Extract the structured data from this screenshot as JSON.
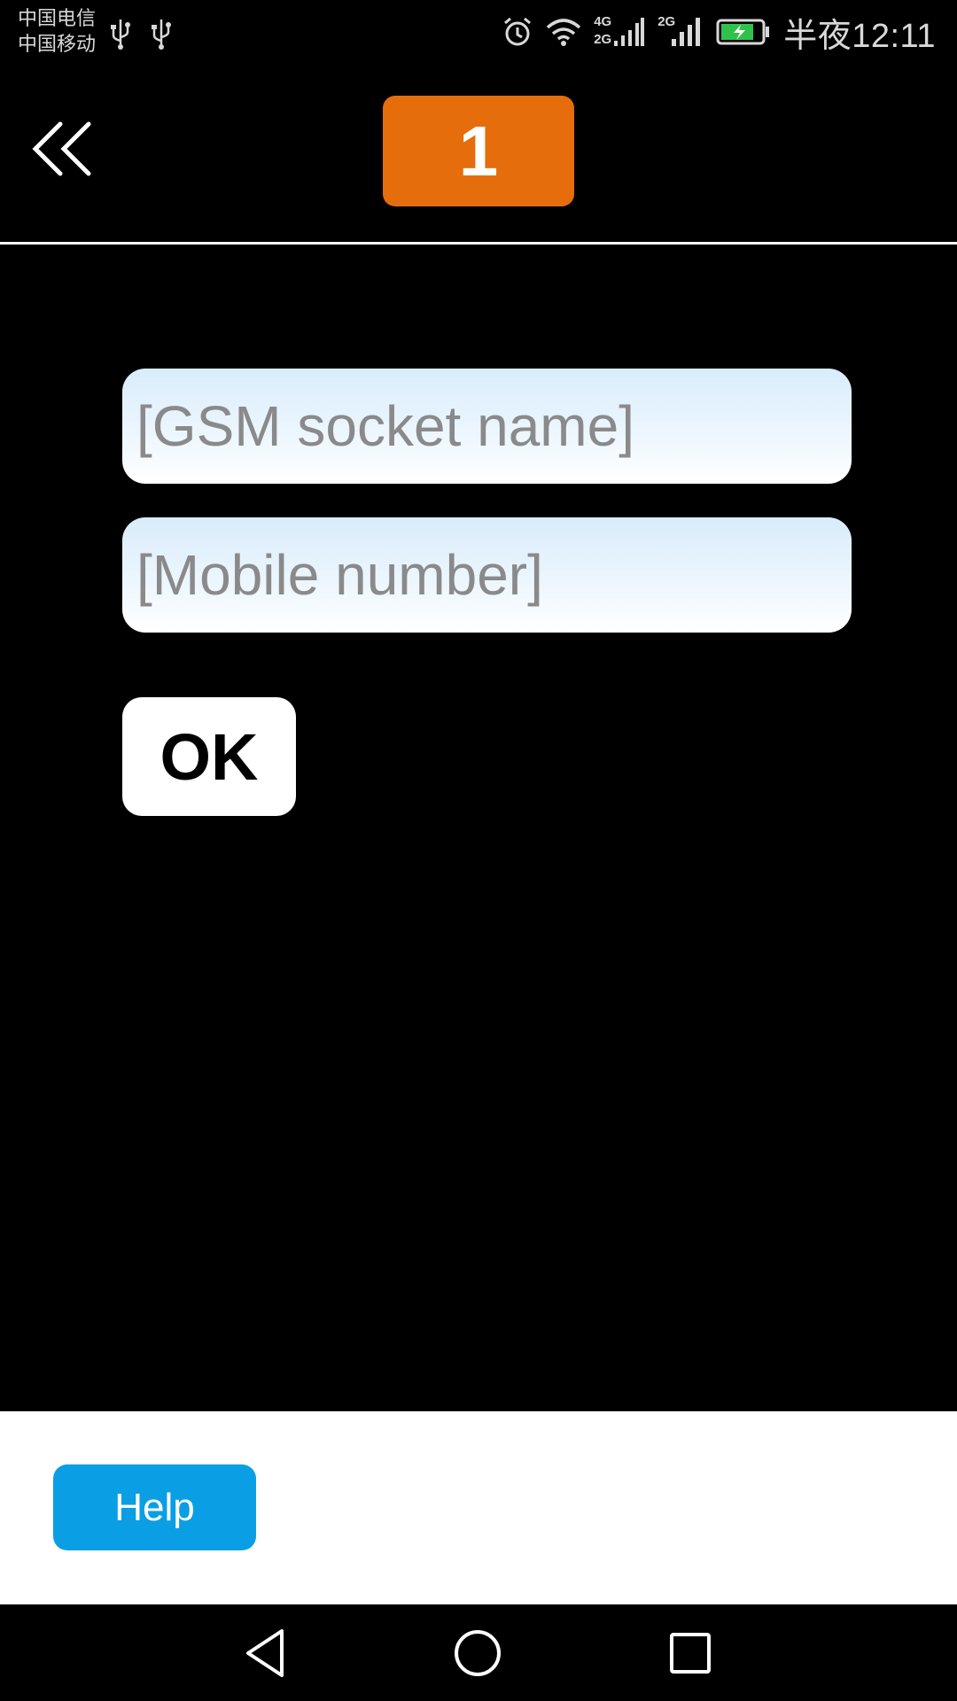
{
  "status_bar": {
    "carrier_1": "中国电信",
    "carrier_2": "中国移动",
    "time": "半夜12:11",
    "icons": [
      "usb-icon",
      "usb-icon",
      "alarm-icon",
      "wifi-icon",
      "signal-4g-icon",
      "signal-2g-icon",
      "battery-charging-icon"
    ],
    "network_labels": {
      "sim1_top": "4G",
      "sim1_bottom": "2G",
      "sim2": "2G"
    }
  },
  "header": {
    "back_icon": "double-chevron-left-icon",
    "badge_number": "1",
    "badge_color": "#e56d0c"
  },
  "form": {
    "socket_name_placeholder": "[GSM socket name]",
    "mobile_number_placeholder": "[Mobile number]",
    "ok_label": "OK"
  },
  "footer": {
    "help_label": "Help",
    "help_color": "#0a9ee5"
  },
  "navigation": {
    "icons": [
      "back-triangle-icon",
      "home-circle-icon",
      "recent-square-icon"
    ]
  }
}
